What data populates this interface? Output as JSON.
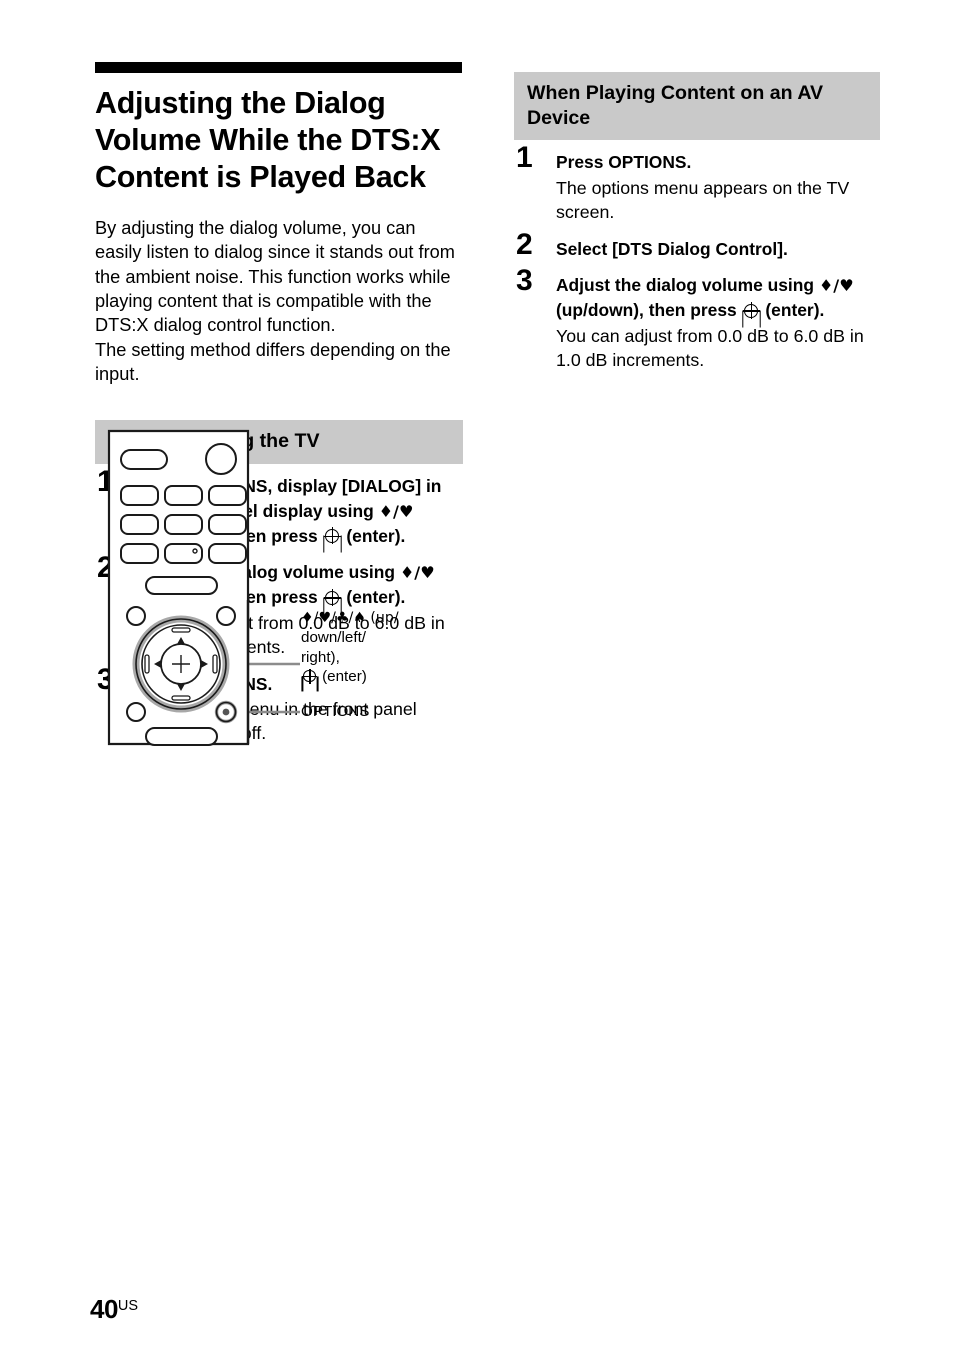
{
  "page": {
    "number": "40",
    "region_suffix": "US"
  },
  "left_column": {
    "title": "Adjusting the Dialog Volume While the DTS:X Content is Played Back",
    "intro_paragraph_1": "By adjusting the dialog volume, you can easily listen to dialog since it stands out from the ambient noise. This function works while playing content that is compatible with the DTS:X dialog control function.",
    "intro_paragraph_2": "The setting method differs depending on the input.",
    "section_heading": "When Watching the TV",
    "steps": [
      {
        "number": "1",
        "title_pre": "Press OPTIONS, display [DIALOG] in the front panel display using ",
        "arrows": "♦/♥",
        "title_mid": " (up/down), then press ",
        "title_post": " (enter).",
        "body": ""
      },
      {
        "number": "2",
        "title_pre": "Adjust the dialog volume using ",
        "arrows": "♦/♥",
        "title_mid": " (up/down), then press ",
        "title_post": " (enter).",
        "body": "You can adjust from 0.0 dB to 6.0 dB in 1.0 dB increments."
      },
      {
        "number": "3",
        "title_pre": "Press OPTIONS.",
        "arrows": "",
        "title_mid": "",
        "title_post": "",
        "body": "The options menu in the front panel display turns off."
      }
    ]
  },
  "right_column": {
    "section_heading": "When Playing Content on an AV Device",
    "steps": [
      {
        "number": "1",
        "title_pre": "Press OPTIONS.",
        "arrows": "",
        "title_mid": "",
        "title_post": "",
        "body": "The options menu appears on the TV screen."
      },
      {
        "number": "2",
        "title_pre": "Select [DTS Dialog Control].",
        "arrows": "",
        "title_mid": "",
        "title_post": "",
        "body": ""
      },
      {
        "number": "3",
        "title_pre": "Adjust the dialog volume using ",
        "arrows": "♦/♥",
        "title_mid": " (up/down), then press ",
        "title_post": " (enter).",
        "body": "You can adjust from 0.0 dB to 6.0 dB in 1.0 dB increments."
      }
    ]
  },
  "diagram": {
    "callout_dpad_line1": "♦/♥/♣/♠ (up/",
    "callout_dpad_line2": "down/left/",
    "callout_dpad_line3": "right),",
    "callout_dpad_line4": " (enter)",
    "callout_options": "OPTIONS"
  },
  "colors": {
    "heading_band": "#c9c9c9",
    "rule": "#000000",
    "highlight_ring": "#9a9a9a"
  }
}
